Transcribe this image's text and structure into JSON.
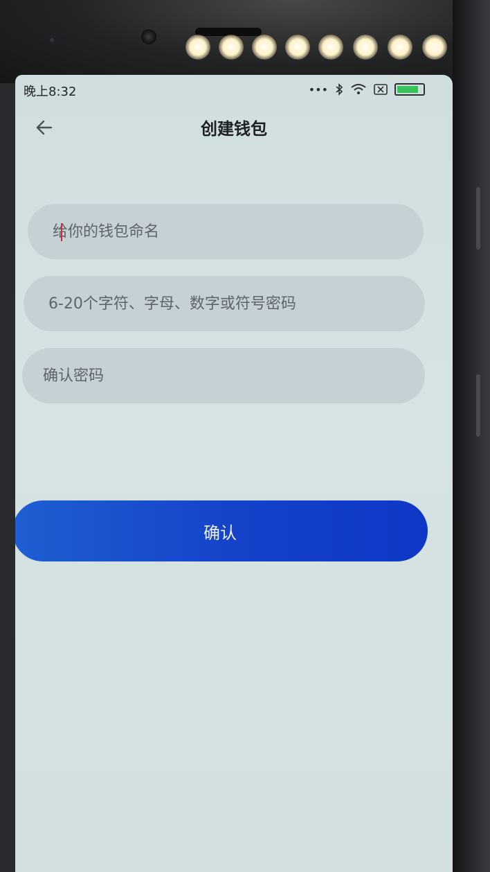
{
  "status_bar": {
    "time": "晚上8:32",
    "icons": [
      "more-dots-icon",
      "bluetooth-icon",
      "wifi-icon",
      "sim-icon",
      "battery-icon"
    ]
  },
  "header": {
    "title": "创建钱包",
    "back_icon": "arrow-left-icon"
  },
  "form": {
    "wallet_name": {
      "value": "",
      "placeholder": "给你的钱包命名"
    },
    "password": {
      "value": "",
      "placeholder": "6-20个字符、字母、数字或符号密码"
    },
    "confirm_password": {
      "value": "",
      "placeholder": "确认密码"
    }
  },
  "actions": {
    "confirm_label": "确认"
  },
  "colors": {
    "primary_button": "#1442c9",
    "screen_background": "#d3e0e1",
    "input_background": "#c5d1d4"
  }
}
